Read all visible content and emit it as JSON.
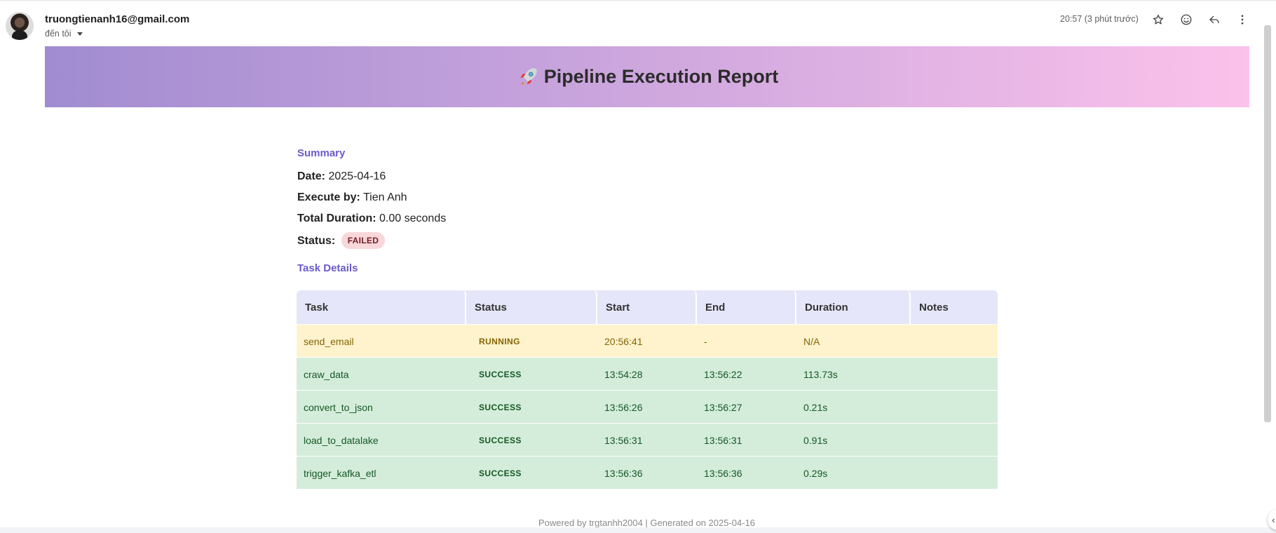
{
  "header": {
    "sender_email": "truongtienanh16@gmail.com",
    "recipient_label": "đến tôi",
    "timestamp": "20:57 (3 phút trước)",
    "icons": [
      "star-icon",
      "emoji-icon",
      "reply-icon",
      "more-vert-icon"
    ]
  },
  "banner": {
    "title": "Pipeline Execution Report",
    "icon": "rocket-icon",
    "gradient": [
      "#a18cd1",
      "#fbc2eb"
    ]
  },
  "summary": {
    "heading": "Summary",
    "date_label": "Date:",
    "date_value": "2025-04-16",
    "executed_by_label": "Execute by:",
    "executed_by_value": "Tien Anh",
    "duration_label": "Total Duration:",
    "duration_value": "0.00 seconds",
    "status_label": "Status:",
    "status_value": "FAILED"
  },
  "tasks": {
    "heading": "Task Details",
    "columns": [
      "Task",
      "Status",
      "Start",
      "End",
      "Duration",
      "Notes"
    ],
    "rows": [
      {
        "task": "send_email",
        "status": "RUNNING",
        "start": "20:56:41",
        "end": "-",
        "duration": "N/A",
        "notes": ""
      },
      {
        "task": "craw_data",
        "status": "SUCCESS",
        "start": "13:54:28",
        "end": "13:56:22",
        "duration": "113.73s",
        "notes": ""
      },
      {
        "task": "convert_to_json",
        "status": "SUCCESS",
        "start": "13:56:26",
        "end": "13:56:27",
        "duration": "0.21s",
        "notes": ""
      },
      {
        "task": "load_to_datalake",
        "status": "SUCCESS",
        "start": "13:56:31",
        "end": "13:56:31",
        "duration": "0.91s",
        "notes": ""
      },
      {
        "task": "trigger_kafka_etl",
        "status": "SUCCESS",
        "start": "13:56:36",
        "end": "13:56:36",
        "duration": "0.29s",
        "notes": ""
      }
    ]
  },
  "footer": {
    "text": "Powered by trgtanhh2004 | Generated on 2025-04-16"
  },
  "colors": {
    "accent": "#6a5acd",
    "header_bg": "#e6e6fa",
    "running_bg": "#fff3cd",
    "success_bg": "#d4edda",
    "failed_badge_bg": "#f8d7da"
  }
}
